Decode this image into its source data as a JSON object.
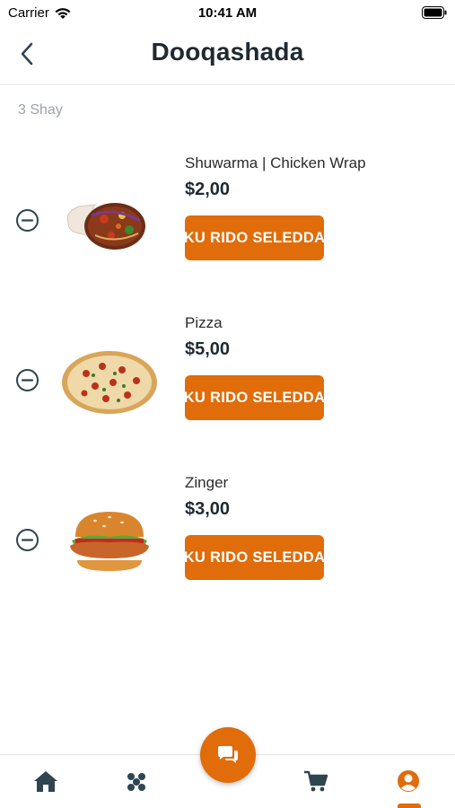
{
  "status_bar": {
    "carrier": "Carrier",
    "time": "10:41 AM"
  },
  "header": {
    "title": "Dooqashada",
    "back_icon": "chevron-left-icon"
  },
  "item_count": "3 Shay",
  "cart": {
    "items": [
      {
        "name": "Shuwarma | Chicken Wrap",
        "price": "$2,00",
        "button_label": "KU RIDO SELEDDA",
        "image": "shawarma-wrap-image"
      },
      {
        "name": "Pizza",
        "price": "$5,00",
        "button_label": "KU RIDO SELEDDA",
        "image": "pizza-image"
      },
      {
        "name": "Zinger",
        "price": "$3,00",
        "button_label": "KU RIDO SELEDDA",
        "image": "zinger-burger-image"
      }
    ]
  },
  "tab_bar": {
    "tabs": [
      {
        "name": "home",
        "icon": "home-icon"
      },
      {
        "name": "categories",
        "icon": "grid-dots-icon"
      },
      {
        "name": "chat",
        "icon": "chat-bubbles-icon"
      },
      {
        "name": "cart",
        "icon": "cart-icon"
      },
      {
        "name": "profile",
        "icon": "user-icon",
        "active": true
      }
    ]
  },
  "colors": {
    "accent": "#e06c0a",
    "title": "#1f2a30",
    "muted": "#9aa3aa",
    "icon": "#2f4550"
  }
}
